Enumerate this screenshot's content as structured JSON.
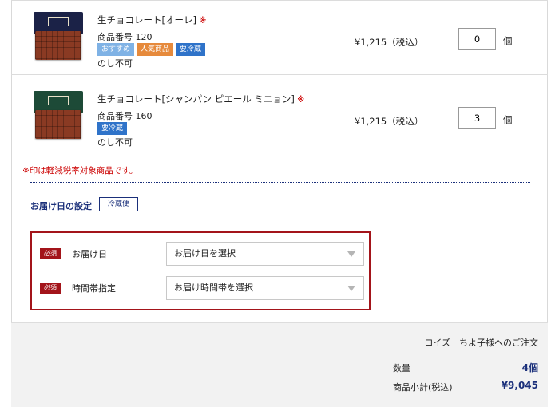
{
  "products": [
    {
      "name": "生チョコレート[オーレ]",
      "mark": "※",
      "code": "商品番号 120",
      "tags": [
        {
          "label": "おすすめ",
          "color": "#7fb2e5"
        },
        {
          "label": "人気商品",
          "color": "#e68a3c"
        },
        {
          "label": "要冷蔵",
          "color": "#2f73c9"
        }
      ],
      "noshi": "のし不可",
      "price": "¥1,215（税込）",
      "quantity": "0",
      "unit": "個",
      "box_color": "#1b2247"
    },
    {
      "name": "生チョコレート[シャンパン ピエール ミニョン]",
      "mark": "※",
      "code": "商品番号 160",
      "tags": [
        {
          "label": "要冷蔵",
          "color": "#2f73c9"
        }
      ],
      "noshi": "のし不可",
      "price": "¥1,215（税込）",
      "quantity": "3",
      "unit": "個",
      "box_color": "#1d4a37"
    }
  ],
  "note": "※印は軽減税率対象商品です。",
  "delivery": {
    "heading": "お届け日の設定",
    "badge": "冷蔵便",
    "required_label": "必須",
    "date_label": "お届け日",
    "date_select": "お届け日を選択",
    "time_label": "時間帯指定",
    "time_select": "お届け時間帯を選択"
  },
  "summary": {
    "order_for": "ロイズ　ちよ子様へのご注文",
    "qty_label": "数量",
    "qty_value": "4個",
    "subtotal_label": "商品小計(税込)",
    "subtotal_value": "¥9,045"
  },
  "colors": {
    "accent_navy": "#1a2f7a",
    "required_red": "#a3141a",
    "note_red": "#cc0000"
  }
}
